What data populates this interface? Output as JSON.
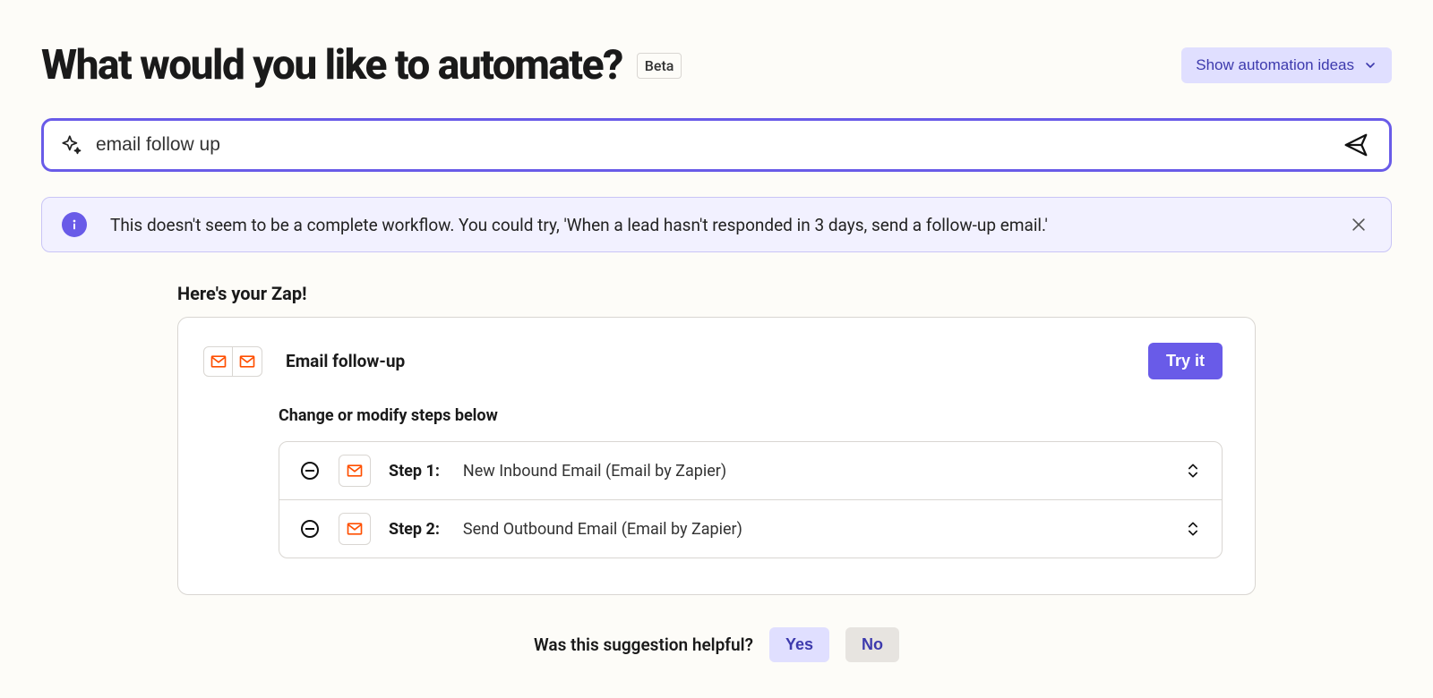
{
  "header": {
    "title": "What would you like to automate?",
    "badge": "Beta",
    "ideas_button": "Show automation ideas"
  },
  "search": {
    "value": "email follow up",
    "placeholder": ""
  },
  "info": {
    "text": "This doesn't seem to be a complete workflow. You could try, 'When a lead hasn't responded in 3 days, send a follow-up email.'"
  },
  "zap": {
    "heading": "Here's your Zap!",
    "title": "Email follow-up",
    "try_label": "Try it",
    "sub_heading": "Change or modify steps below",
    "steps": [
      {
        "label": "Step 1:",
        "desc": "New Inbound Email (Email by Zapier)"
      },
      {
        "label": "Step 2:",
        "desc": "Send Outbound Email (Email by Zapier)"
      }
    ]
  },
  "feedback": {
    "prompt": "Was this suggestion helpful?",
    "yes": "Yes",
    "no": "No"
  },
  "colors": {
    "primary": "#695be8",
    "orange": "#ff4f00"
  }
}
